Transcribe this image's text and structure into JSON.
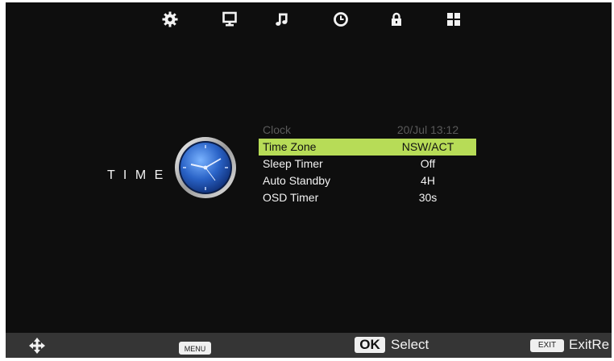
{
  "top_nav": {
    "icons": [
      "gear-icon",
      "monitor-icon",
      "music-note-icon",
      "clock-icon",
      "lock-icon",
      "grid-icon"
    ],
    "active": "clock-icon"
  },
  "page": {
    "title": "T I M E",
    "icon": "analog-clock-icon"
  },
  "menu": {
    "items": [
      {
        "label": "Clock",
        "value": "20/Jul 13:12",
        "state": "disabled"
      },
      {
        "label": "Time Zone",
        "value": "NSW/ACT",
        "state": "selected"
      },
      {
        "label": "Sleep Timer",
        "value": "Off",
        "state": "normal"
      },
      {
        "label": "Auto Standby",
        "value": "4H",
        "state": "normal"
      },
      {
        "label": "OSD Timer",
        "value": "30s",
        "state": "normal"
      }
    ]
  },
  "footer": {
    "nav_icon": "dpad-arrows-icon",
    "menu_key": "MENU",
    "ok_key": "OK",
    "ok_label": "Select",
    "exit_key": "EXIT",
    "exit_label": "ExitRe"
  },
  "colors": {
    "screen_bg": "#0e0e0e",
    "highlight": "#b7dc57",
    "footer_bg": "#353535",
    "disabled_text": "#5a5a5a"
  }
}
